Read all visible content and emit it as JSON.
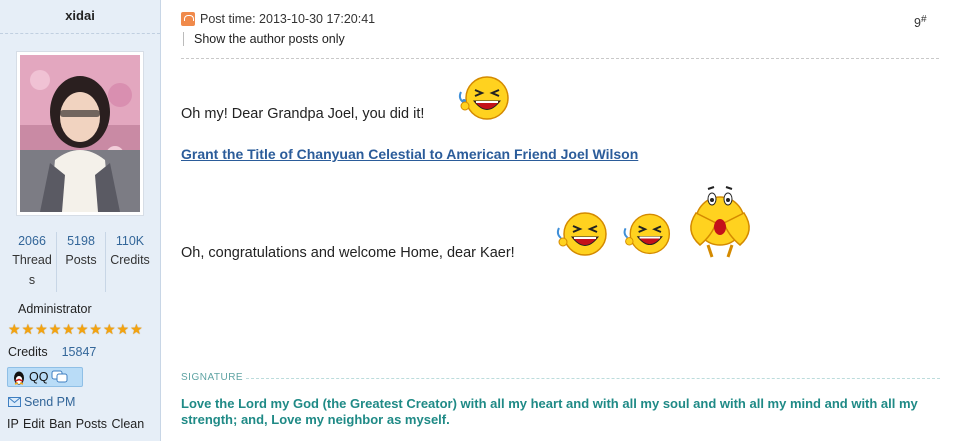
{
  "user": {
    "name": "xidai",
    "stats": [
      {
        "value": "2066",
        "label": "Threads"
      },
      {
        "value": "5198",
        "label": "Posts"
      },
      {
        "value": "110K",
        "label": "Credits"
      }
    ],
    "role": "Administrator",
    "stars": 10,
    "credits_label": "Credits",
    "credits_value": "15847",
    "qq_label": "QQ",
    "send_pm": "Send PM",
    "tools": "IP Edit Ban Posts Clean"
  },
  "post": {
    "time": "Post time: 2013-10-30 17:20:41",
    "author_only": "Show the author posts only",
    "floor": "9",
    "floor_mark": "#",
    "line1": "Oh my! Dear Grandpa Joel, you did it!",
    "link": "Grant the Title of Chanyuan Celestial to American Friend Joel Wilson",
    "line2": "Oh, congratulations and welcome Home, dear Kaer!",
    "signature_label": "SIGNATURE",
    "signature": "Love the Lord my God (the Greatest Creator) with all my heart and with all my soul and with all my mind and with all my strength; and, Love my neighbor as myself."
  },
  "icons": [
    "post-icon",
    "laughing-emoticon",
    "cheering-emoticon",
    "qq-penguin-icon",
    "chat-bubble-icon",
    "mail-icon",
    "star-icon"
  ],
  "colors": {
    "link": "#2b5c9a",
    "signature": "#1f8a86",
    "sidebar": "#e6eef7",
    "stat": "#336699"
  }
}
